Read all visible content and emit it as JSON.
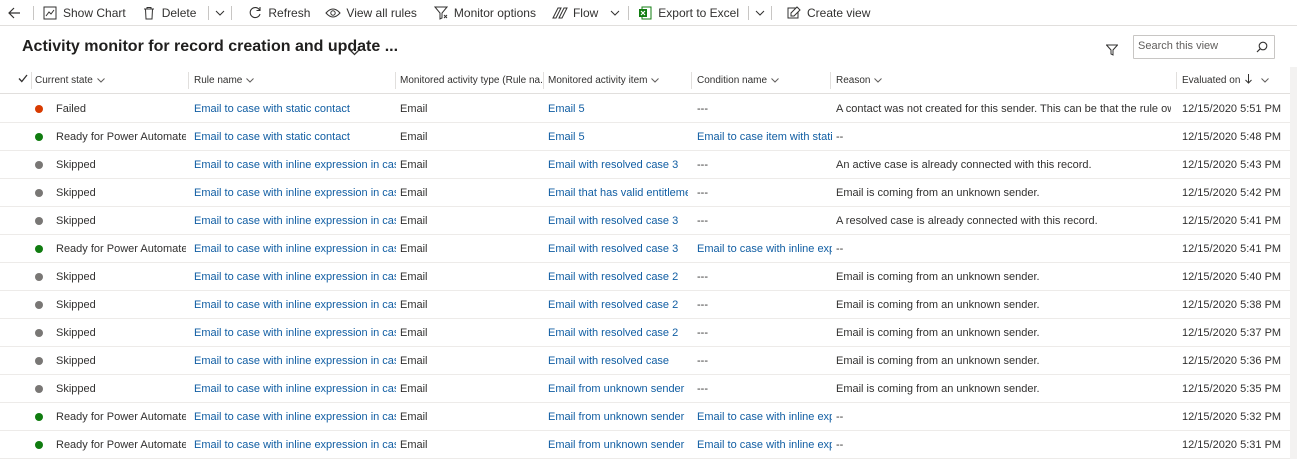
{
  "toolbar": {
    "show_chart": "Show Chart",
    "delete": "Delete",
    "refresh": "Refresh",
    "view_all_rules": "View all rules",
    "monitor_options": "Monitor options",
    "flow": "Flow",
    "export_to_excel": "Export to Excel",
    "create_view": "Create view"
  },
  "view": {
    "title": "Activity monitor for record creation and update ...",
    "search_placeholder": "Search this view"
  },
  "columns": {
    "current_state": "Current state",
    "rule_name": "Rule name",
    "monitored_activity_type": "Monitored activity type (Rule na...",
    "monitored_activity_item": "Monitored activity item",
    "condition_name": "Condition name",
    "reason": "Reason",
    "evaluated_on": "Evaluated on"
  },
  "colors": {
    "failed": "#d83b01",
    "ready": "#107c10",
    "skipped": "#797775",
    "link": "#115ea3"
  },
  "rows": [
    {
      "state": "Failed",
      "status": "failed",
      "rule": "Email to case with static contact",
      "type": "Email",
      "item": "Email 5",
      "condition": "---",
      "condition_link": false,
      "reason": "A contact was not created for this sender. This can be that the rule ow...",
      "evaluated": "12/15/2020 5:51 PM"
    },
    {
      "state": "Ready for Power Automate",
      "status": "ready",
      "rule": "Email to case with static contact",
      "type": "Email",
      "item": "Email 5",
      "condition": "Email to case item with static co",
      "condition_link": true,
      "reason": "--",
      "evaluated": "12/15/2020 5:48 PM"
    },
    {
      "state": "Skipped",
      "status": "skipped",
      "rule": "Email to case with inline expression in case cus",
      "type": "Email",
      "item": "Email with resolved case 3",
      "condition": "---",
      "condition_link": false,
      "reason": "An active case is already connected with this record.",
      "evaluated": "12/15/2020 5:43 PM"
    },
    {
      "state": "Skipped",
      "status": "skipped",
      "rule": "Email to case with inline expression in case cus",
      "type": "Email",
      "item": "Email that has valid entitlement",
      "condition": "---",
      "condition_link": false,
      "reason": "Email is coming from an unknown sender.",
      "evaluated": "12/15/2020 5:42 PM"
    },
    {
      "state": "Skipped",
      "status": "skipped",
      "rule": "Email to case with inline expression in case cus",
      "type": "Email",
      "item": "Email with resolved case 3",
      "condition": "---",
      "condition_link": false,
      "reason": "A resolved case is already connected with this record.",
      "evaluated": "12/15/2020 5:41 PM"
    },
    {
      "state": "Ready for Power Automate",
      "status": "ready",
      "rule": "Email to case with inline expression in case cus",
      "type": "Email",
      "item": "Email with resolved case 3",
      "condition": "Email to case with inline expres",
      "condition_link": true,
      "reason": "--",
      "evaluated": "12/15/2020 5:41 PM"
    },
    {
      "state": "Skipped",
      "status": "skipped",
      "rule": "Email to case with inline expression in case cus",
      "type": "Email",
      "item": "Email with resolved case 2",
      "condition": "---",
      "condition_link": false,
      "reason": "Email is coming from an unknown sender.",
      "evaluated": "12/15/2020 5:40 PM"
    },
    {
      "state": "Skipped",
      "status": "skipped",
      "rule": "Email to case with inline expression in case cus",
      "type": "Email",
      "item": "Email with resolved case 2",
      "condition": "---",
      "condition_link": false,
      "reason": "Email is coming from an unknown sender.",
      "evaluated": "12/15/2020 5:38 PM"
    },
    {
      "state": "Skipped",
      "status": "skipped",
      "rule": "Email to case with inline expression in case cus",
      "type": "Email",
      "item": "Email with resolved case 2",
      "condition": "---",
      "condition_link": false,
      "reason": "Email is coming from an unknown sender.",
      "evaluated": "12/15/2020 5:37 PM"
    },
    {
      "state": "Skipped",
      "status": "skipped",
      "rule": "Email to case with inline expression in case cus",
      "type": "Email",
      "item": "Email with resolved case",
      "condition": "---",
      "condition_link": false,
      "reason": "Email is coming from an unknown sender.",
      "evaluated": "12/15/2020 5:36 PM"
    },
    {
      "state": "Skipped",
      "status": "skipped",
      "rule": "Email to case with inline expression in case cus",
      "type": "Email",
      "item": "Email from unknown sender",
      "condition": "---",
      "condition_link": false,
      "reason": "Email is coming from an unknown sender.",
      "evaluated": "12/15/2020 5:35 PM"
    },
    {
      "state": "Ready for Power Automate",
      "status": "ready",
      "rule": "Email to case with inline expression in case cus",
      "type": "Email",
      "item": "Email from unknown sender",
      "condition": "Email to case with inline expres",
      "condition_link": true,
      "reason": "--",
      "evaluated": "12/15/2020 5:32 PM"
    },
    {
      "state": "Ready for Power Automate",
      "status": "ready",
      "rule": "Email to case with inline expression in case cus",
      "type": "Email",
      "item": "Email from unknown sender",
      "condition": "Email to case with inline expres",
      "condition_link": true,
      "reason": "--",
      "evaluated": "12/15/2020 5:31 PM"
    }
  ]
}
